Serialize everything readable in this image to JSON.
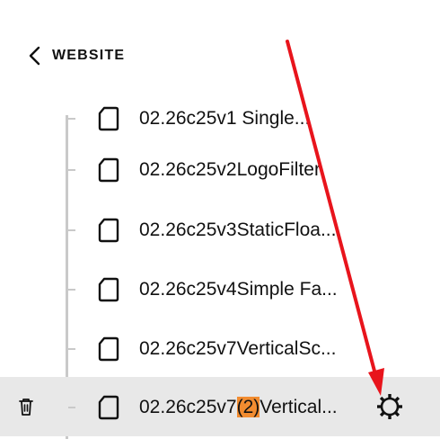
{
  "header": {
    "back_label": "WEBSITE"
  },
  "list": {
    "items": [
      {
        "label": "02.26c25v1 Single..."
      },
      {
        "label": "02.26c25v2LogoFilter"
      },
      {
        "label": "02.26c25v3StaticFloa..."
      },
      {
        "label": "02.26c25v4Simple Fa..."
      },
      {
        "label": "02.26c25v7VerticalSc..."
      },
      {
        "label_prefix": "02.26c25v7",
        "label_highlight": "(2)",
        "label_suffix": "Vertical...",
        "selected": true
      }
    ]
  },
  "icons": {
    "back": "chevron-left-icon",
    "page": "page-icon",
    "trash": "trash-icon",
    "settings": "gear-icon"
  },
  "colors": {
    "highlight": "#f28c30",
    "selected_row": "#e8e8e8",
    "annotation_arrow": "#e8141c",
    "tree_line": "#c9c9c9"
  }
}
